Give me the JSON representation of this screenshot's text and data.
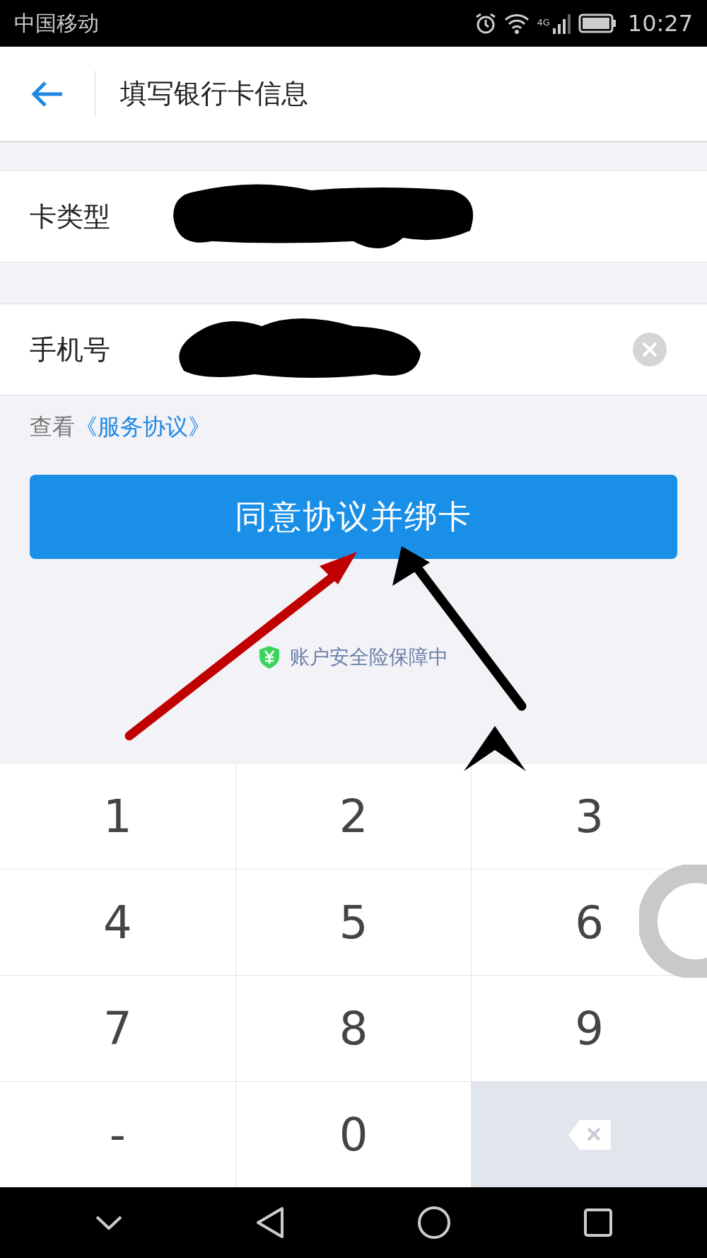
{
  "status_bar": {
    "carrier": "中国移动",
    "network": "4G",
    "time": "10:27"
  },
  "header": {
    "title": "填写银行卡信息"
  },
  "fields": [
    {
      "label": "卡类型",
      "redacted": true,
      "clearable": false
    },
    {
      "label": "手机号",
      "redacted": true,
      "clearable": true
    }
  ],
  "agreement": {
    "prefix": "查看",
    "link": "《服务协议》"
  },
  "submit_button": "同意协议并绑卡",
  "security_note": "账户安全险保障中",
  "keypad": [
    {
      "kind": "key",
      "label": "1"
    },
    {
      "kind": "key",
      "label": "2"
    },
    {
      "kind": "key",
      "label": "3"
    },
    {
      "kind": "key",
      "label": "4"
    },
    {
      "kind": "key",
      "label": "5"
    },
    {
      "kind": "key",
      "label": "6"
    },
    {
      "kind": "key",
      "label": "7"
    },
    {
      "kind": "key",
      "label": "8"
    },
    {
      "kind": "key",
      "label": "9"
    },
    {
      "kind": "key",
      "label": "-"
    },
    {
      "kind": "key",
      "label": "0"
    },
    {
      "kind": "backspace"
    }
  ],
  "annotations": [
    {
      "kind": "arrow",
      "color": "#c00000"
    },
    {
      "kind": "arrow",
      "color": "#000000"
    }
  ]
}
